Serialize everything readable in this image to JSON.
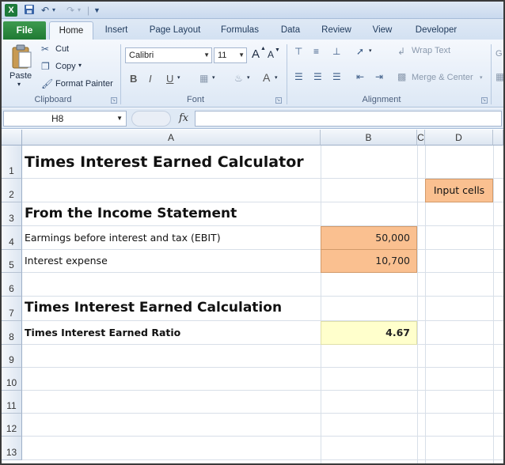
{
  "colors": {
    "file_tab": "#1f7a33",
    "input_fill": "#fac090",
    "result_fill": "#ffffcc"
  },
  "qat": {
    "app_icon": "X",
    "save_icon": "save-icon",
    "undo_icon": "undo-icon",
    "redo_icon": "redo-icon"
  },
  "tabs": {
    "file": "File",
    "home": "Home",
    "insert": "Insert",
    "page_layout": "Page Layout",
    "formulas": "Formulas",
    "data": "Data",
    "review": "Review",
    "view": "View",
    "developer": "Developer"
  },
  "clipboard": {
    "paste": "Paste",
    "cut": "Cut",
    "copy": "Copy",
    "format_painter": "Format Painter",
    "label": "Clipboard"
  },
  "font": {
    "name": "Calibri",
    "size": "11",
    "grow": "A",
    "shrink": "A",
    "bold": "B",
    "italic": "I",
    "underline": "U",
    "color_letter": "A",
    "label": "Font"
  },
  "alignment": {
    "wrap_text": "Wrap Text",
    "merge_center": "Merge & Center",
    "label": "Alignment"
  },
  "partial_group": "G",
  "formula_bar": {
    "name_box": "H8",
    "fx": "fx",
    "value": ""
  },
  "columns": [
    "A",
    "B",
    "C",
    "D"
  ],
  "rows": [
    "1",
    "2",
    "3",
    "4",
    "5",
    "6",
    "7",
    "8",
    "9",
    "10",
    "11",
    "12",
    "13"
  ],
  "sheet": {
    "title": "Times Interest Earned Calculator",
    "input_legend": "Input cells",
    "section_income": "From the Income Statement",
    "ebit_label": "Earmings before interest and tax (EBIT)",
    "ebit_value": "50,000",
    "interest_label": "Interest expense",
    "interest_value": "10,700",
    "section_calc": "Times Interest Earned Calculation",
    "ratio_label": "Times Interest Earned Ratio",
    "ratio_value": "4.67"
  }
}
